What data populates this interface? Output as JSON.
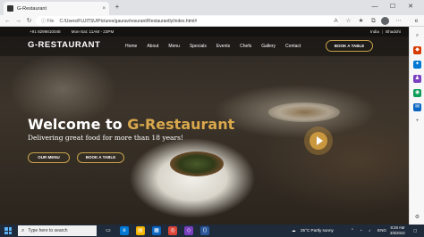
{
  "browser": {
    "tab_title": "G-Restaurant",
    "tab_close": "×",
    "new_tab": "+",
    "file_chip": "ⓘ File",
    "url": "C:/Users/FUJITSU/Pictures/gaurav/resurant/Restaurantly/index.html#"
  },
  "topbar": {
    "phone": "+91 8299810048",
    "hours": "Mon-Sat: 11AM - 23PM",
    "country": "India",
    "city": "Bhadohi"
  },
  "navbar": {
    "brand": "G-RESTAURANT",
    "items": [
      "Home",
      "About",
      "Menu",
      "Specials",
      "Events",
      "Chefs",
      "Gallery",
      "Contact"
    ],
    "book_button": "BOOK A TABLE"
  },
  "hero": {
    "title_prefix": "Welcome to ",
    "title_accent": "G-Restaurant",
    "subtitle": "Delivering great food for more than 18 years!",
    "our_menu_button": "OUR MENU",
    "book_button": "BOOK A TABLE"
  },
  "taskbar": {
    "search_placeholder": "Type here to search",
    "weather": "25°C  Partly sunny",
    "time": "8:28 AM",
    "date": "3/5/2022"
  },
  "colors": {
    "accent": "#d9a84c",
    "taskbar": "#1f2a3a"
  }
}
